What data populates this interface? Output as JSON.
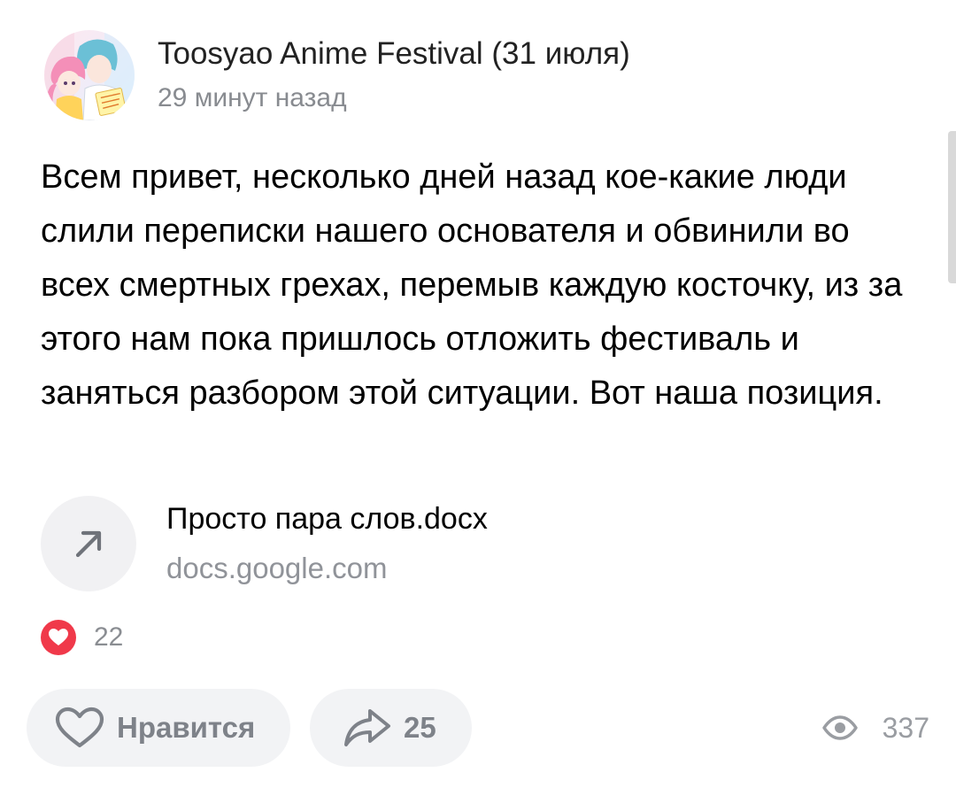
{
  "post": {
    "channel_name": "Toosyao Anime Festival (31 июля)",
    "time_ago": "29 минут назад",
    "body": "Всем привет, несколько дней назад кое-какие люди слили переписки нашего основателя и обвинили во всех смертных грехах, перемыв каждую косточку, из за этого нам пока пришлось отложить фестиваль и заняться разбором этой ситуации. Вот наша позиция."
  },
  "link": {
    "title": "Просто пара слов.docx",
    "domain": "docs.google.com",
    "icon": "arrow-up-right-icon"
  },
  "reactions": {
    "icon": "heart-icon",
    "count": "22",
    "color": "#f0394a"
  },
  "actions": {
    "like_label": "Нравится",
    "like_icon": "heart-outline-icon",
    "share_count": "25",
    "share_icon": "share-arrow-icon",
    "views_count": "337",
    "views_icon": "eye-icon"
  }
}
